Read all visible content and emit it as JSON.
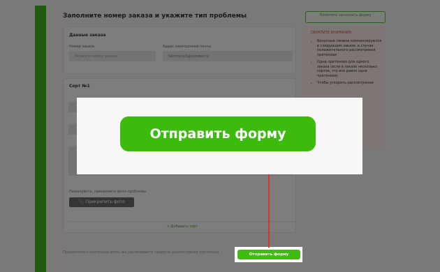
{
  "page": {
    "title": "Заполните номер заказа и укажите тип проблемы",
    "help_button": "Помогите заполнить форму"
  },
  "order": {
    "section_title": "Данные заказа",
    "order_label": "Номер заказа",
    "order_placeholder": "Укажите номер заказа",
    "email_label": "Адрес электронной почты",
    "email_value": "Semoynich@yandex.ru"
  },
  "variety": {
    "section_title": "Сорт №1",
    "photo_label": "Пожалуйста, прикрепите фото проблемы",
    "attach_button": "Прикрепить фото",
    "add_variety": "+ Добавить сорт"
  },
  "note": {
    "title": "ОБРАТИТЕ ВНИМАНИЕ:",
    "items": [
      "Бонусные семена компенсируются в следующем заказе, в случае положительного рассмотрения претензии",
      "Одна претензия для одного заказа (если в заказе несколько сортов, это все равно одна претензия)",
      "Чтобы ускорить рассмотрение"
    ]
  },
  "footer": {
    "note": "Прикрепите к претензии фото, вы увеличиваете скорость рассмотрения претензии"
  },
  "submit": {
    "label": "Отправить форму",
    "zoom_label": "Отправить форму"
  },
  "colors": {
    "accent_green": "#3cbb0c",
    "connector_red": "#e0302e"
  }
}
